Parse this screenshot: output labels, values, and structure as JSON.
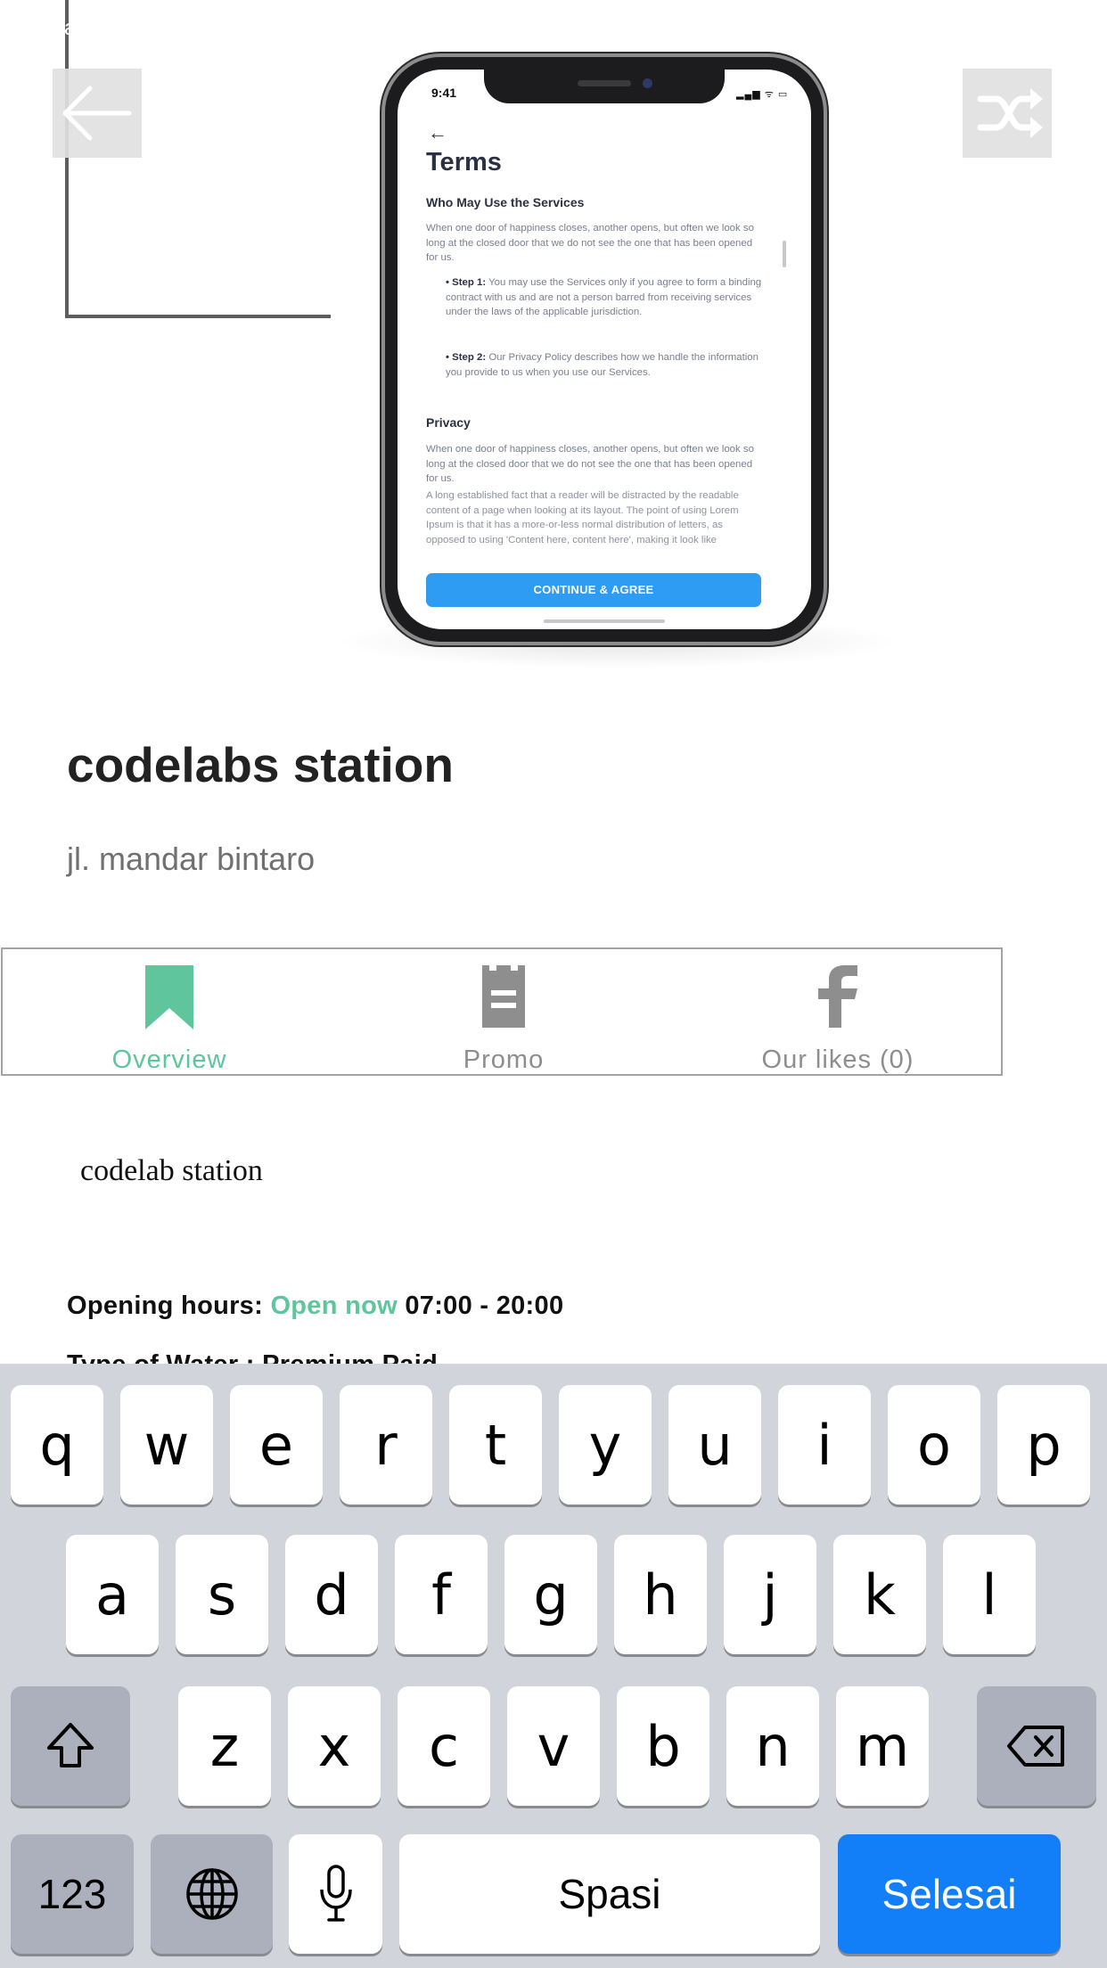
{
  "status_stray": "a",
  "nav": {
    "back_icon": "arrow-left-icon",
    "shuffle_icon": "shuffle-icon"
  },
  "mockup": {
    "time": "9:41",
    "status_icons": "▂▄▆ ᯤ ▭",
    "back": "←",
    "title": "Terms",
    "section1_heading": "Who May Use the Services",
    "section1_para": "When one door of happiness closes, another opens, but often we look so long at the closed door that we do not see the one that has been opened for us.",
    "step1_label": "• Step 1:",
    "step1_text": "You may use the Services only if you agree to form a binding contract with us and are not a person barred from receiving services under the laws of the applicable jurisdiction.",
    "step2_label": "• Step 2:",
    "step2_text": "Our Privacy Policy describes how we handle the information you provide to us when you use our Services.",
    "section2_heading": "Privacy",
    "section2_para": "When one door of happiness closes, another opens, but often we look so long at the closed door that we do not see the one that has been opened for us.",
    "section2_para2": "A long established fact that a reader will be distracted by the readable content of a page when looking at its layout. The point of using Lorem Ipsum is that it has a more-or-less normal distribution of letters, as opposed to using 'Content here, content here', making it look like",
    "cta": "CONTINUE & AGREE"
  },
  "venue": {
    "title": "codelabs station",
    "address": "jl. mandar bintaro"
  },
  "tabs": [
    {
      "label": "Overview",
      "icon": "bookmark-icon",
      "active": true,
      "color": "#5fc59d"
    },
    {
      "label": "Promo",
      "icon": "coupon-icon",
      "active": false,
      "color": "#8e8e8e"
    },
    {
      "label": "Our likes (0)",
      "icon": "facebook-icon",
      "active": false,
      "color": "#8e8e8e"
    }
  ],
  "overview": {
    "description": "codelab station",
    "hours_label": "Opening hours:",
    "hours_status": "Open now",
    "hours_time": "07:00 - 20:00",
    "water": "Type of Water : Premium Paid"
  },
  "keyboard": {
    "row1": [
      "q",
      "w",
      "e",
      "r",
      "t",
      "y",
      "u",
      "i",
      "o",
      "p"
    ],
    "row2": [
      "a",
      "s",
      "d",
      "f",
      "g",
      "h",
      "j",
      "k",
      "l"
    ],
    "row3": [
      "z",
      "x",
      "c",
      "v",
      "b",
      "n",
      "m"
    ],
    "shift_icon": "shift-icon",
    "backspace_icon": "backspace-icon",
    "numbers": "123",
    "globe_icon": "globe-icon",
    "mic_icon": "microphone-icon",
    "space": "Spasi",
    "done": "Selesai"
  },
  "colors": {
    "accent": "#5fc59d",
    "keyboard_blue": "#127ef7",
    "inactive": "#8e8e8e"
  }
}
